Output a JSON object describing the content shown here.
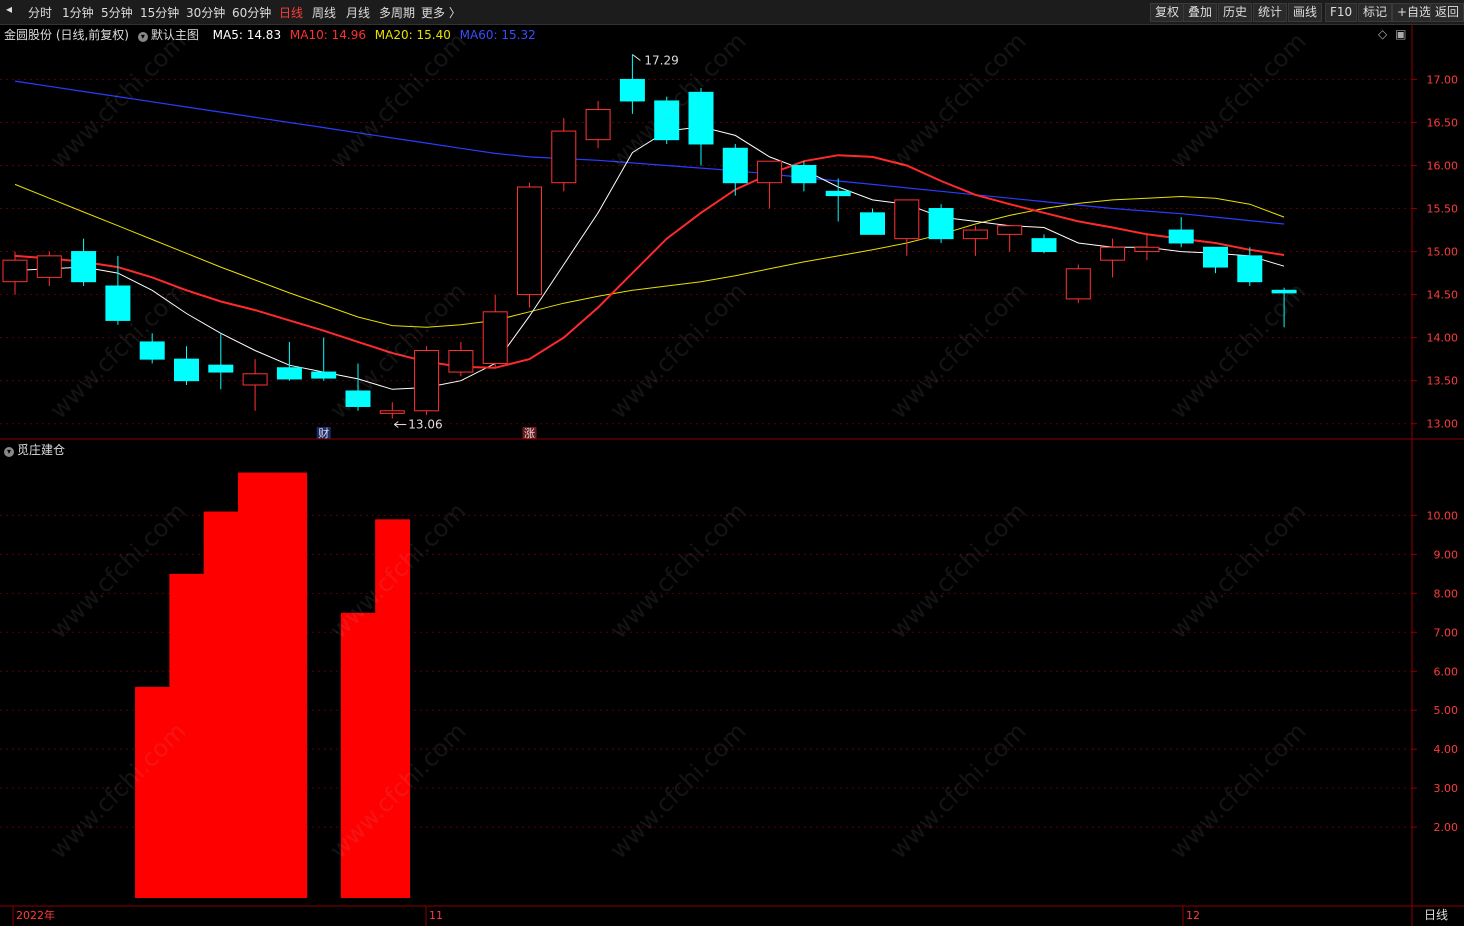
{
  "toolbar": {
    "left": [
      "分时",
      "1分钟",
      "5分钟",
      "15分钟",
      "30分钟",
      "60分钟",
      "日线",
      "周线",
      "月线",
      "多周期",
      "更多 〉"
    ],
    "active": "日线",
    "right": [
      "复权",
      "叠加",
      "历史",
      "统计",
      "画线",
      "F10",
      "标记",
      "+自选",
      "返回"
    ]
  },
  "info": {
    "stock": "金圆股份 (日线,前复权)",
    "template": "默认主图",
    "ma5": "MA5: 14.83",
    "ma10": "MA10: 14.96",
    "ma20": "MA20: 15.40",
    "ma60": "MA60: 15.32"
  },
  "colors": {
    "up": "#ff3232",
    "down": "#00ffff",
    "ma5": "#ffffff",
    "ma10": "#ff2a2a",
    "ma20": "#e8e000",
    "ma60": "#2a3cff",
    "indicator": "#ff0000"
  },
  "indicator_title": "觅庄建仓",
  "period_label": "日线",
  "chart_data": [
    {
      "type": "candlestick",
      "title": "金圆股份 (日线,前复权)",
      "ylim": [
        12.95,
        17.4
      ],
      "y_ticks": [
        "17.00",
        "16.50",
        "16.00",
        "15.50",
        "15.00",
        "14.50",
        "14.00",
        "13.50",
        "13.00"
      ],
      "x_labels": [
        "2022年",
        "11",
        "12"
      ],
      "candles": [
        {
          "o": 14.65,
          "h": 15.0,
          "l": 14.5,
          "c": 14.9
        },
        {
          "o": 14.7,
          "h": 15.0,
          "l": 14.6,
          "c": 14.95
        },
        {
          "o": 15.0,
          "h": 15.15,
          "l": 14.6,
          "c": 14.65
        },
        {
          "o": 14.6,
          "h": 14.95,
          "l": 14.15,
          "c": 14.2
        },
        {
          "o": 13.95,
          "h": 14.05,
          "l": 13.7,
          "c": 13.75
        },
        {
          "o": 13.75,
          "h": 13.9,
          "l": 13.45,
          "c": 13.5
        },
        {
          "o": 13.68,
          "h": 14.05,
          "l": 13.4,
          "c": 13.6
        },
        {
          "o": 13.45,
          "h": 13.75,
          "l": 13.15,
          "c": 13.58
        },
        {
          "o": 13.65,
          "h": 13.95,
          "l": 13.5,
          "c": 13.52
        },
        {
          "o": 13.6,
          "h": 14.0,
          "l": 13.5,
          "c": 13.53
        },
        {
          "o": 13.38,
          "h": 13.7,
          "l": 13.15,
          "c": 13.2
        },
        {
          "o": 13.12,
          "h": 13.25,
          "l": 13.06,
          "c": 13.15
        },
        {
          "o": 13.15,
          "h": 13.9,
          "l": 13.1,
          "c": 13.85
        },
        {
          "o": 13.6,
          "h": 13.95,
          "l": 13.55,
          "c": 13.85
        },
        {
          "o": 13.7,
          "h": 14.5,
          "l": 13.65,
          "c": 14.3
        },
        {
          "o": 14.5,
          "h": 15.8,
          "l": 14.35,
          "c": 15.75
        },
        {
          "o": 15.8,
          "h": 16.55,
          "l": 15.7,
          "c": 16.4
        },
        {
          "o": 16.3,
          "h": 16.75,
          "l": 16.2,
          "c": 16.65
        },
        {
          "o": 17.0,
          "h": 17.29,
          "l": 16.6,
          "c": 16.75
        },
        {
          "o": 16.75,
          "h": 16.8,
          "l": 16.25,
          "c": 16.3
        },
        {
          "o": 16.85,
          "h": 16.9,
          "l": 16.0,
          "c": 16.25
        },
        {
          "o": 16.2,
          "h": 16.25,
          "l": 15.65,
          "c": 15.8
        },
        {
          "o": 15.8,
          "h": 16.05,
          "l": 15.5,
          "c": 16.05
        },
        {
          "o": 16.0,
          "h": 16.05,
          "l": 15.7,
          "c": 15.8
        },
        {
          "o": 15.7,
          "h": 15.85,
          "l": 15.35,
          "c": 15.65
        },
        {
          "o": 15.45,
          "h": 15.5,
          "l": 15.2,
          "c": 15.2
        },
        {
          "o": 15.15,
          "h": 15.3,
          "l": 14.95,
          "c": 15.6
        },
        {
          "o": 15.5,
          "h": 15.55,
          "l": 15.1,
          "c": 15.15
        },
        {
          "o": 15.15,
          "h": 15.3,
          "l": 14.95,
          "c": 15.25
        },
        {
          "o": 15.2,
          "h": 15.2,
          "l": 15.0,
          "c": 15.3
        },
        {
          "o": 15.15,
          "h": 15.2,
          "l": 14.98,
          "c": 15.0
        },
        {
          "o": 14.45,
          "h": 14.85,
          "l": 14.4,
          "c": 14.8
        },
        {
          "o": 14.9,
          "h": 15.15,
          "l": 14.7,
          "c": 15.05
        },
        {
          "o": 15.0,
          "h": 15.2,
          "l": 14.9,
          "c": 15.05
        },
        {
          "o": 15.25,
          "h": 15.4,
          "l": 15.05,
          "c": 15.1
        },
        {
          "o": 15.05,
          "h": 15.05,
          "l": 14.75,
          "c": 14.82
        },
        {
          "o": 14.95,
          "h": 15.05,
          "l": 14.6,
          "c": 14.65
        },
        {
          "o": 14.55,
          "h": 14.58,
          "l": 14.12,
          "c": 14.52
        }
      ],
      "ma5": [
        14.78,
        14.8,
        14.82,
        14.75,
        14.55,
        14.28,
        14.05,
        13.85,
        13.68,
        13.6,
        13.52,
        13.4,
        13.42,
        13.5,
        13.7,
        14.25,
        14.85,
        15.45,
        16.15,
        16.4,
        16.45,
        16.35,
        16.1,
        15.95,
        15.75,
        15.6,
        15.55,
        15.4,
        15.35,
        15.3,
        15.28,
        15.1,
        15.05,
        15.05,
        15.0,
        14.98,
        14.95,
        14.83
      ],
      "ma10": [
        14.95,
        14.92,
        14.88,
        14.82,
        14.7,
        14.55,
        14.42,
        14.32,
        14.2,
        14.08,
        13.95,
        13.82,
        13.72,
        13.66,
        13.65,
        13.75,
        14.0,
        14.35,
        14.75,
        15.15,
        15.45,
        15.72,
        15.9,
        16.05,
        16.12,
        16.1,
        16.0,
        15.82,
        15.66,
        15.55,
        15.45,
        15.35,
        15.28,
        15.2,
        15.15,
        15.1,
        15.02,
        14.96
      ],
      "ma20": [
        15.78,
        15.62,
        15.46,
        15.3,
        15.14,
        14.98,
        14.82,
        14.67,
        14.52,
        14.38,
        14.24,
        14.14,
        14.12,
        14.15,
        14.2,
        14.3,
        14.4,
        14.48,
        14.55,
        14.6,
        14.65,
        14.72,
        14.8,
        14.88,
        14.95,
        15.02,
        15.1,
        15.2,
        15.32,
        15.42,
        15.5,
        15.56,
        15.6,
        15.62,
        15.64,
        15.62,
        15.55,
        15.4
      ],
      "ma60": [
        16.98,
        16.92,
        16.86,
        16.8,
        16.74,
        16.68,
        16.62,
        16.56,
        16.5,
        16.44,
        16.38,
        16.32,
        16.26,
        16.2,
        16.14,
        16.1,
        16.08,
        16.06,
        16.03,
        16.0,
        15.97,
        15.94,
        15.9,
        15.86,
        15.82,
        15.78,
        15.74,
        15.7,
        15.66,
        15.62,
        15.58,
        15.54,
        15.5,
        15.47,
        15.44,
        15.4,
        15.36,
        15.32
      ],
      "annotations": [
        {
          "label": "17.29",
          "index": 18,
          "value": 17.29
        },
        {
          "label": "13.06",
          "index": 11,
          "value": 13.06
        },
        {
          "label": "财",
          "index": 9
        },
        {
          "label": "涨",
          "index": 15
        }
      ]
    },
    {
      "type": "bar",
      "title": "觅庄建仓",
      "ylim": [
        0,
        11.5
      ],
      "y_ticks": [
        "10.00",
        "9.00",
        "8.00",
        "7.00",
        "6.00",
        "5.00",
        "4.00",
        "3.00",
        "2.00"
      ],
      "values": [
        0,
        0,
        0,
        0,
        5.6,
        8.5,
        10.1,
        11.1,
        11.1,
        0,
        7.5,
        9.9,
        0,
        0,
        0,
        0,
        0,
        0,
        0,
        0,
        0,
        0,
        0,
        0,
        0,
        0,
        0,
        0,
        0,
        0,
        0,
        0,
        0,
        0,
        0,
        0,
        0,
        0
      ]
    }
  ]
}
